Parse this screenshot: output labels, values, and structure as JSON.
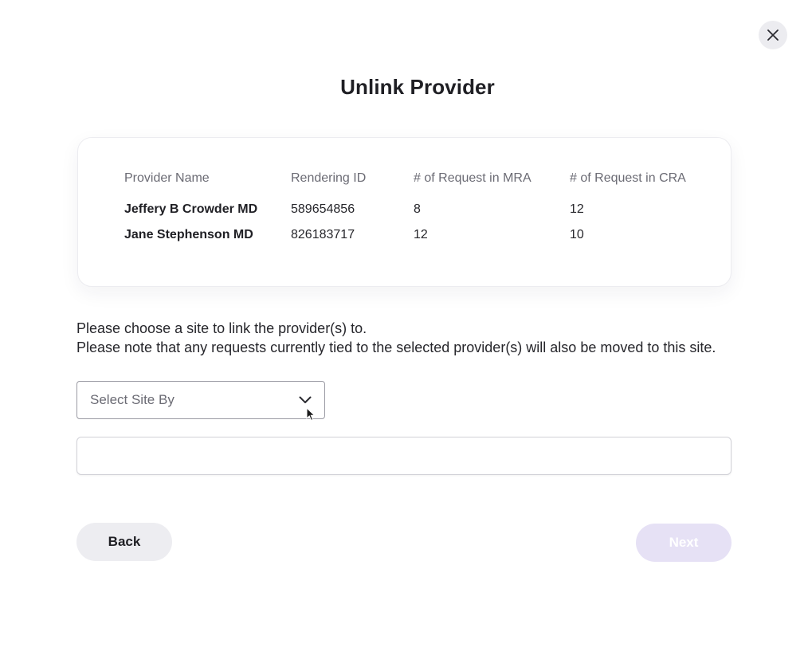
{
  "dialog": {
    "title": "Unlink Provider",
    "close_icon": "close-icon"
  },
  "table": {
    "headers": [
      "Provider Name",
      "Rendering ID",
      "# of Request in MRA",
      "# of Request in CRA"
    ],
    "rows": [
      [
        "Jeffery B Crowder MD",
        "589654856",
        "8",
        "12"
      ],
      [
        "Jane Stephenson MD",
        "826183717",
        "12",
        "10"
      ]
    ]
  },
  "note": {
    "line1": "Please choose a site to link the provider(s) to.",
    "line2": "Please note that any requests currently tied to the selected provider(s) will also be moved to this site."
  },
  "select": {
    "label": "Select Site By",
    "icon": "chevron-down-icon"
  },
  "site_input": {
    "value": "",
    "placeholder": ""
  },
  "buttons": {
    "back": "Back",
    "next": "Next"
  },
  "colors": {
    "next_disabled_bg": "#e6e1f5",
    "back_bg": "#ededf1",
    "close_bg": "#ececf0"
  }
}
